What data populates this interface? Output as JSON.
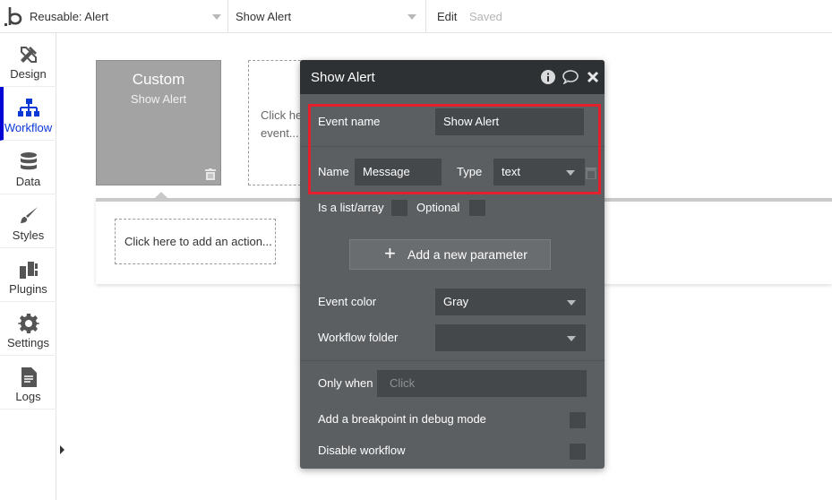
{
  "topbar": {
    "page_select": "Reusable: Alert",
    "workflow_select": "Show Alert",
    "edit_label": "Edit",
    "saved_label": "Saved"
  },
  "sidebar": {
    "items": [
      {
        "label": "Design",
        "icon": "design-icon"
      },
      {
        "label": "Workflow",
        "icon": "workflow-icon"
      },
      {
        "label": "Data",
        "icon": "database-icon"
      },
      {
        "label": "Styles",
        "icon": "brush-icon"
      },
      {
        "label": "Plugins",
        "icon": "plug-icon"
      },
      {
        "label": "Settings",
        "icon": "gear-icon"
      },
      {
        "label": "Logs",
        "icon": "document-icon"
      }
    ]
  },
  "canvas": {
    "event_card": {
      "title": "Custom",
      "subtitle": "Show Alert"
    },
    "add_event_text": "Click here to add an event...",
    "add_action_text": "Click here to add an action..."
  },
  "panel": {
    "title": "Show Alert",
    "event_name_label": "Event name",
    "event_name_value": "Show Alert",
    "param_name_label": "Name",
    "param_name_value": "Message",
    "param_type_label": "Type",
    "param_type_value": "text",
    "is_list_label": "Is a list/array",
    "optional_label": "Optional",
    "add_parameter_label": "Add a new parameter",
    "event_color_label": "Event color",
    "event_color_value": "Gray",
    "workflow_folder_label": "Workflow folder",
    "workflow_folder_value": "",
    "only_when_label": "Only when",
    "only_when_placeholder": "Click",
    "breakpoint_label": "Add a breakpoint in debug mode",
    "disable_label": "Disable workflow"
  },
  "colors": {
    "panel_bg": "#5c5f62",
    "panel_header": "#2e3133",
    "highlight": "#e3202b",
    "active_nav": "#0205d3"
  }
}
